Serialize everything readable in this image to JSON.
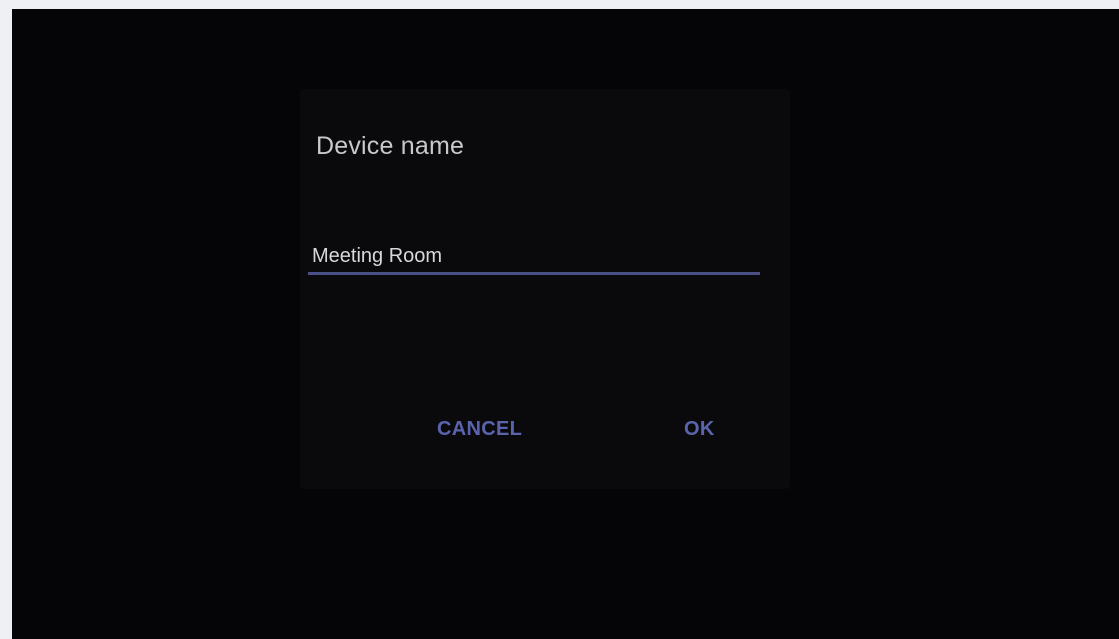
{
  "dialog": {
    "title": "Device name",
    "field_value": "Meeting Room",
    "cancel_label": "CANCEL",
    "ok_label": "OK"
  },
  "colors": {
    "accent": "#5a64ad",
    "underline": "#4a4f86",
    "background": "#050507",
    "title_text": "#c9c9cc"
  }
}
